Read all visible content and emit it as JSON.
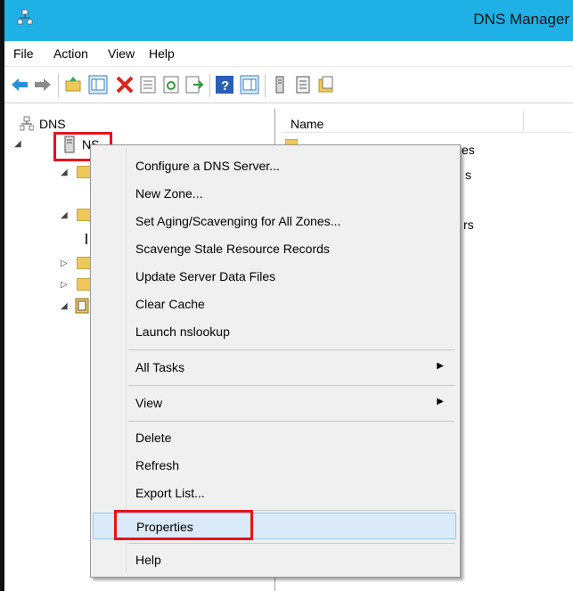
{
  "window": {
    "title": "DNS Manager",
    "titlebar_color": "#1fb0e6"
  },
  "menu": [
    "File",
    "Action",
    "View",
    "Help"
  ],
  "toolbar_icons": [
    "back-arrow-icon",
    "forward-arrow-icon",
    "up-folder-icon",
    "show-hide-tree-icon",
    "delete-icon",
    "properties-icon",
    "refresh-icon",
    "export-list-icon",
    "help-icon",
    "action-pane-icon",
    "server-icon",
    "list-icon",
    "new-zone-icon"
  ],
  "tree": {
    "root_label": "DNS",
    "server_label": "NS"
  },
  "list": {
    "column_name": "Name",
    "partial_items": [
      "es",
      "s",
      "rs"
    ]
  },
  "context_menu": {
    "items": [
      {
        "label": "Configure a DNS Server..."
      },
      {
        "label": "New Zone..."
      },
      {
        "label": "Set Aging/Scavenging for All Zones..."
      },
      {
        "label": "Scavenge Stale Resource Records"
      },
      {
        "label": "Update Server Data Files"
      },
      {
        "label": "Clear Cache"
      },
      {
        "label": "Launch nslookup"
      },
      {
        "label": "All Tasks",
        "submenu": true
      },
      {
        "label": "View",
        "submenu": true
      },
      {
        "label": "Delete"
      },
      {
        "label": "Refresh"
      },
      {
        "label": "Export List..."
      },
      {
        "label": "Properties",
        "highlighted": true
      },
      {
        "label": "Help"
      }
    ],
    "submenu_arrow": "▶"
  },
  "highlight_color": "#e4141e"
}
